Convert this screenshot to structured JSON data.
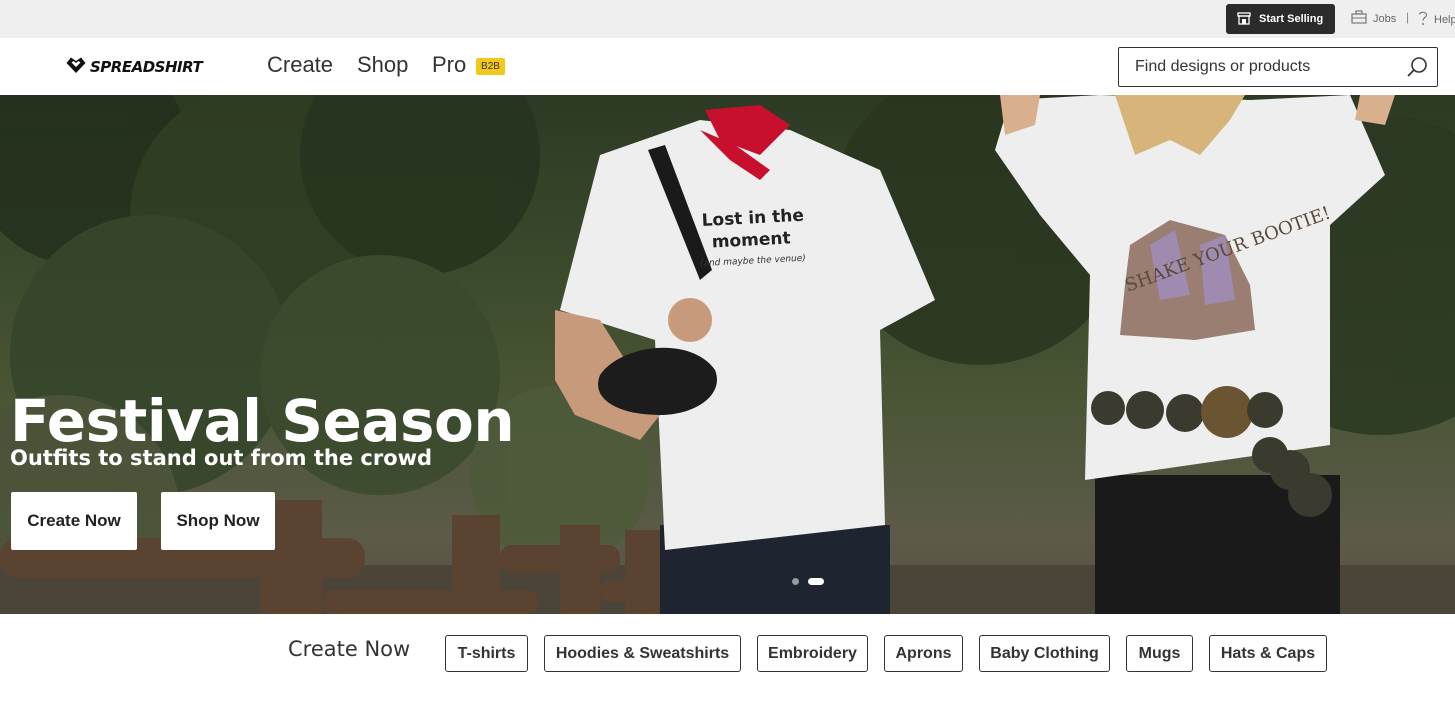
{
  "topbar": {
    "start_selling": "Start Selling",
    "jobs": "Jobs",
    "separator": "|",
    "help": "Help",
    "icons": [
      "store-icon",
      "briefcase-icon",
      "question-icon"
    ]
  },
  "header": {
    "logo_text": "SPREADSHIRT",
    "nav": [
      "Create",
      "Shop",
      "Pro"
    ],
    "pro_badge": "B2B",
    "search_placeholder": "Find designs or products",
    "colors": {
      "badge": "#f3c81b",
      "dark": "#2b2b2b"
    }
  },
  "hero": {
    "title": "Festival Season",
    "subtitle": "Outfits to stand out from the crowd",
    "buttons": [
      "Create Now",
      "Shop Now"
    ],
    "shirt_left_line1": "Lost in the",
    "shirt_left_line2": "moment",
    "shirt_left_line3": "(and maybe the venue)",
    "shirt_right_text": "SHAKE YOUR BOOTIE!",
    "carousel": {
      "slides": 2,
      "active_index": 1
    }
  },
  "categories": {
    "title": "Create Now",
    "items": [
      "T-shirts",
      "Hoodies & Sweatshirts",
      "Embroidery",
      "Aprons",
      "Baby Clothing",
      "Mugs",
      "Hats & Caps"
    ]
  }
}
